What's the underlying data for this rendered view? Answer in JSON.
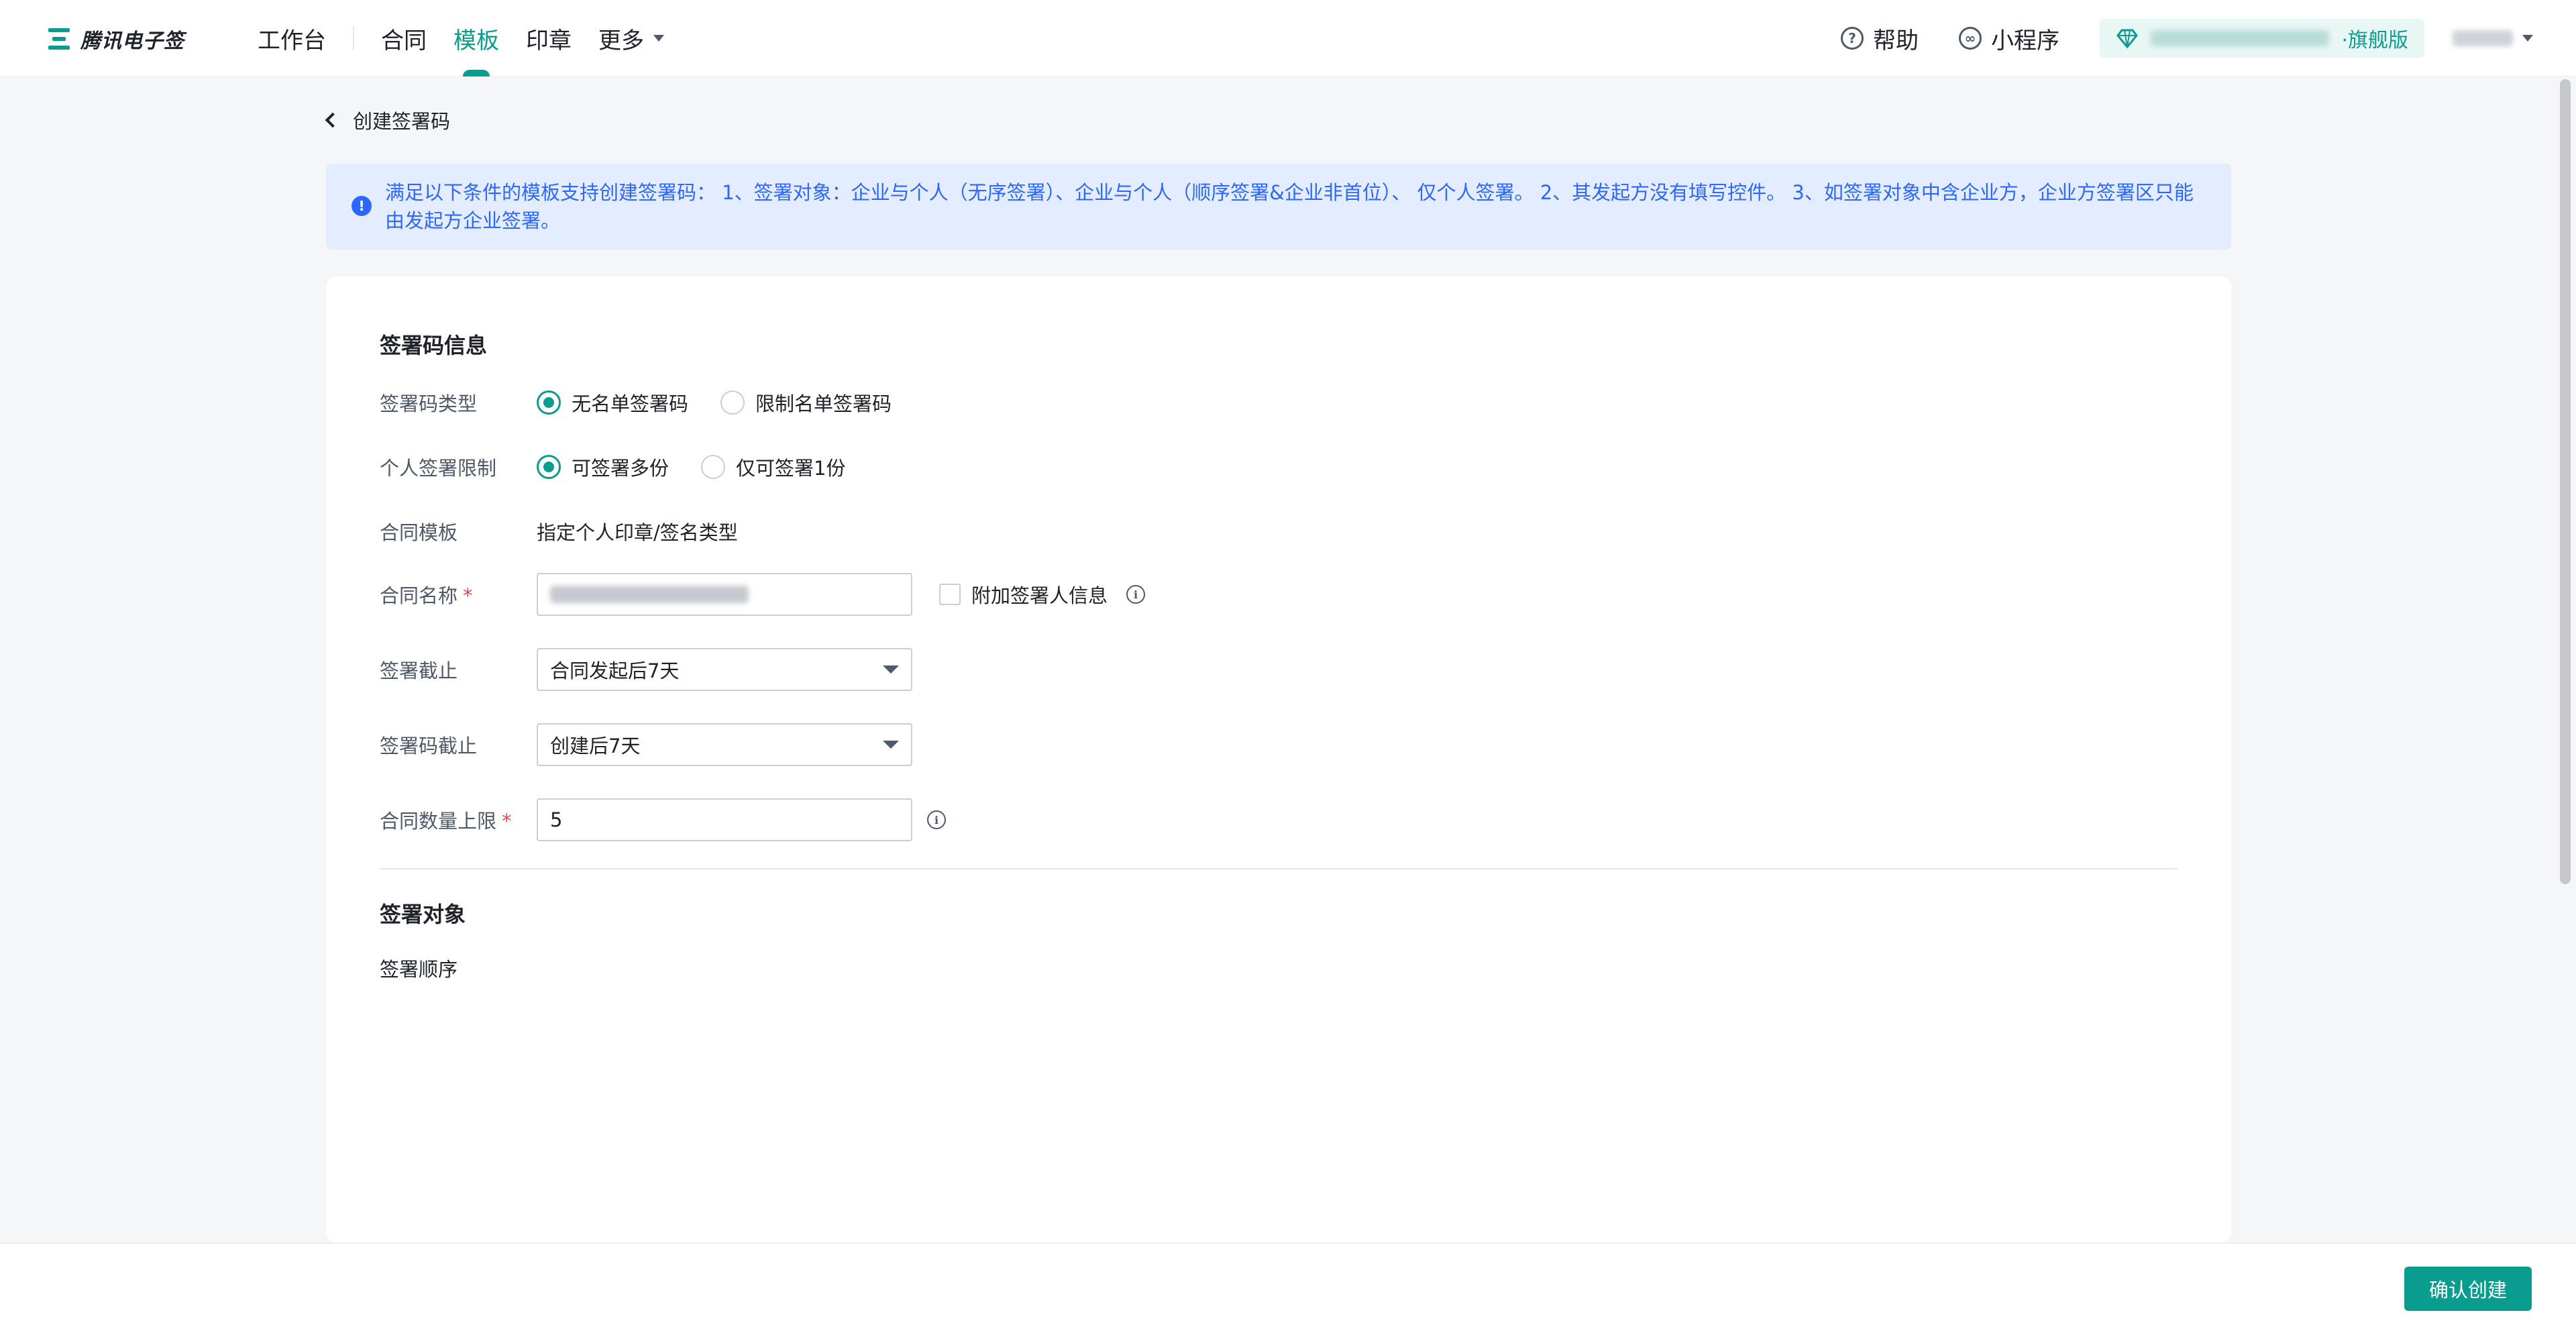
{
  "brand": {
    "logo_text": "腾讯电子签"
  },
  "nav": {
    "workbench": "工作台",
    "items": [
      "合同",
      "模板",
      "印章",
      "更多"
    ],
    "active": "模板"
  },
  "top_right": {
    "help": "帮助",
    "mini_program": "小程序",
    "edition_tag": "·旗舰版"
  },
  "page": {
    "back_label": "创建签署码",
    "notice": "满足以下条件的模板支持创建签署码： 1、签署对象：企业与个人（无序签署）、企业与个人（顺序签署&企业非首位）、 仅个人签署。 2、其发起方没有填写控件。 3、如签署对象中含企业方，企业方签署区只能由发起方企业签署。"
  },
  "form": {
    "section_title": "签署码信息",
    "code_type": {
      "label": "签署码类型",
      "options": [
        "无名单签署码",
        "限制名单签署码"
      ],
      "selected": "无名单签署码"
    },
    "personal_limit": {
      "label": "个人签署限制",
      "options": [
        "可签署多份",
        "仅可签署1份"
      ],
      "selected": "可签署多份"
    },
    "contract_template": {
      "label": "合同模板",
      "value": "指定个人印章/签名类型"
    },
    "contract_name": {
      "label": "合同名称",
      "required_mark": "*",
      "checkbox_label": "附加签署人信息",
      "checked": false
    },
    "sign_deadline": {
      "label": "签署截止",
      "value": "合同发起后7天"
    },
    "code_deadline": {
      "label": "签署码截止",
      "value": "创建后7天"
    },
    "contract_limit": {
      "label": "合同数量上限",
      "required_mark": "*",
      "value": "5"
    },
    "signer_section_title": "签署对象",
    "sign_order_label": "签署顺序"
  },
  "footer": {
    "confirm_label": "确认创建"
  },
  "colors": {
    "accent": "#0a9d8f",
    "notice_bg": "#e4edff",
    "notice_text": "#2c68ff",
    "required": "#e5484d"
  }
}
